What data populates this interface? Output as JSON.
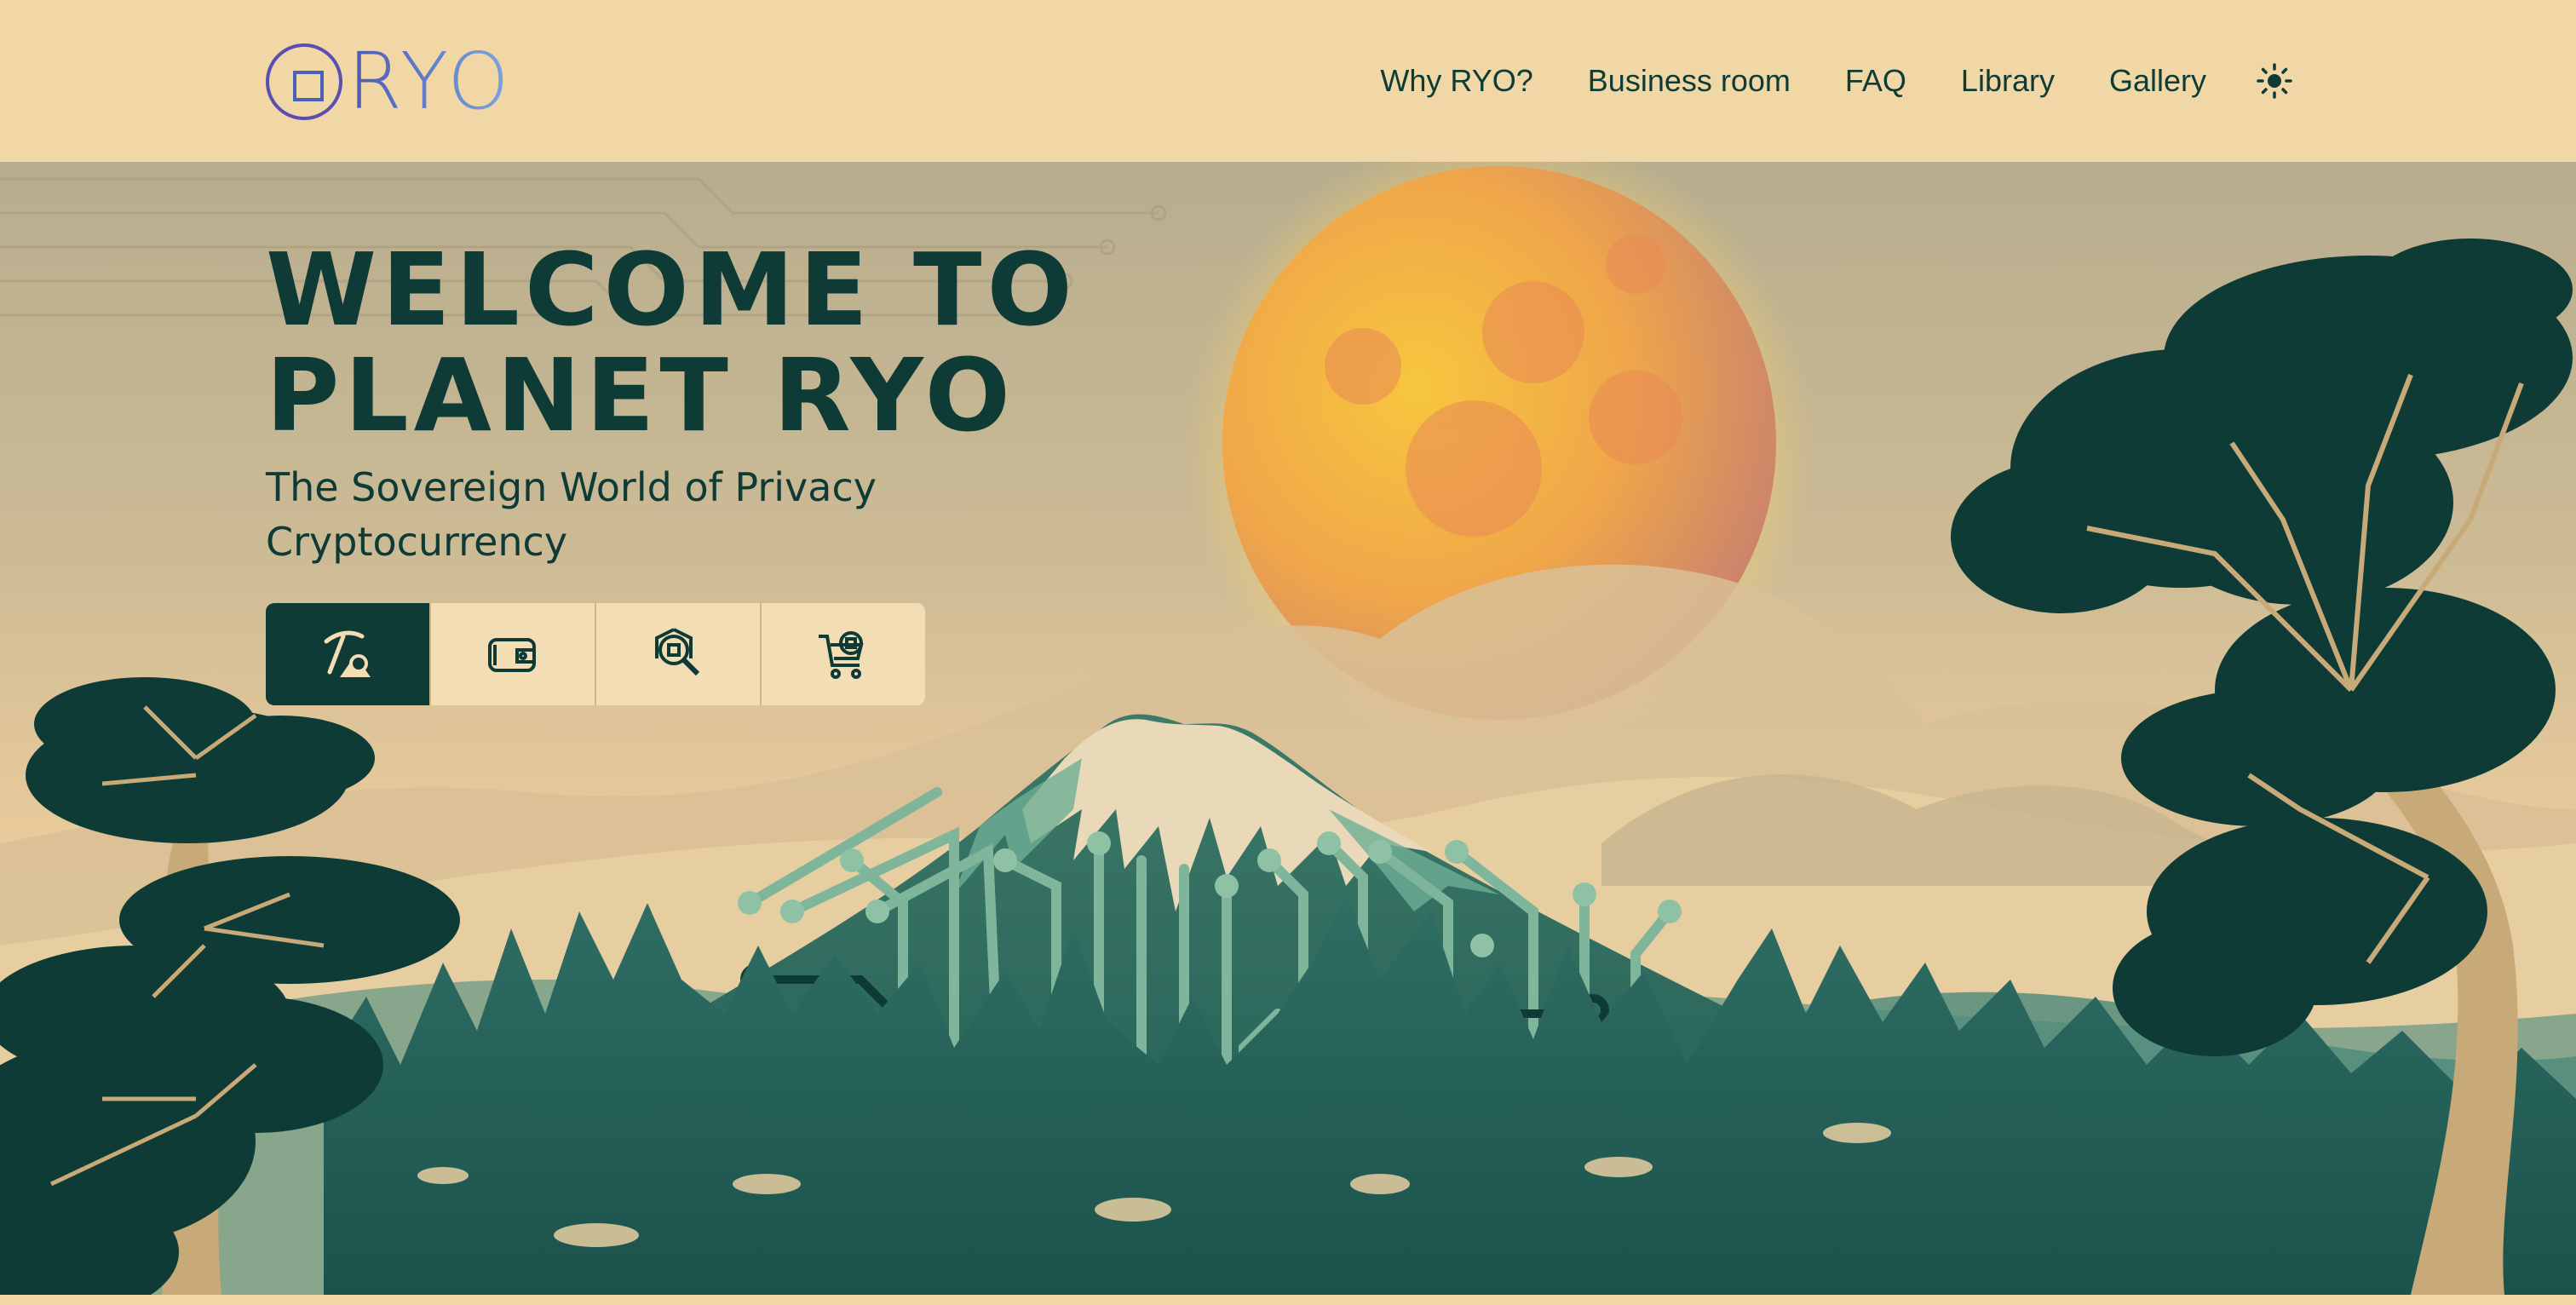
{
  "brand": {
    "logo_text": "RYO",
    "logo_icon": "ryo-logo-icon"
  },
  "nav": {
    "items": [
      {
        "label": "Why RYO?"
      },
      {
        "label": "Business room"
      },
      {
        "label": "FAQ"
      },
      {
        "label": "Library"
      },
      {
        "label": "Gallery"
      }
    ],
    "theme_toggle_icon": "sun-icon"
  },
  "hero": {
    "title_line1": "WELCOME TO",
    "title_line2": "PLANET RYO",
    "subtitle_line1": "The Sovereign World of Privacy",
    "subtitle_line2": "Cryptocurrency",
    "actions": [
      {
        "icon": "mining-pickaxe-icon",
        "active": true
      },
      {
        "icon": "wallet-icon",
        "active": false
      },
      {
        "icon": "blockchain-explorer-icon",
        "active": false
      },
      {
        "icon": "shop-cart-icon",
        "active": false
      }
    ]
  },
  "colors": {
    "background": "#F1D6A6",
    "primary_dark": "#0E3B36",
    "mountain_green": "#2E6A5E",
    "circuit_light": "#7FB59A",
    "moon_yellow": "#F2B233"
  }
}
